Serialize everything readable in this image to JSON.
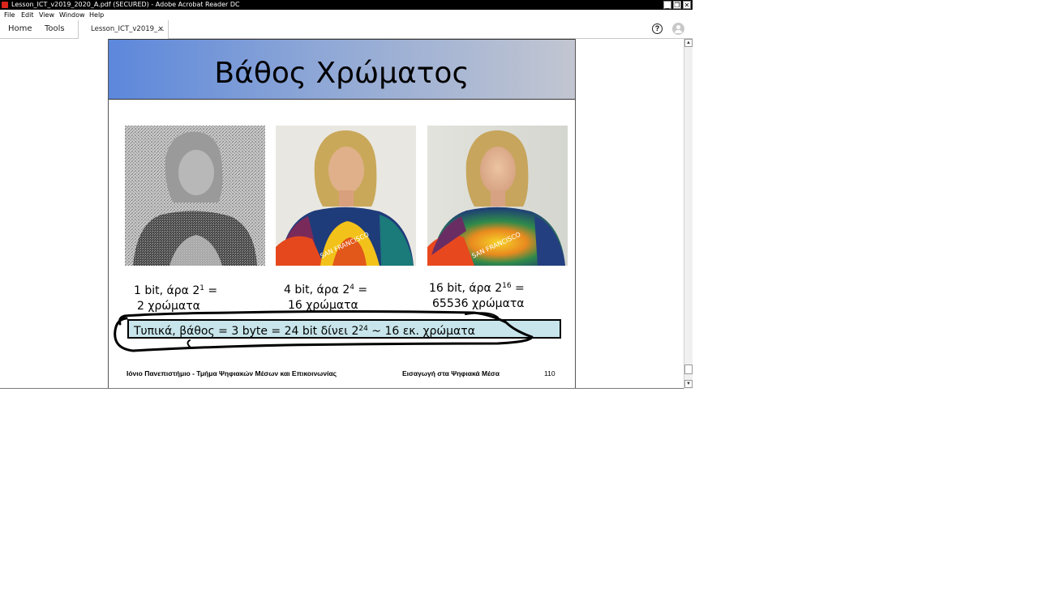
{
  "window": {
    "title": "Lesson_ICT_v2019_2020_A.pdf (SECURED) - Adobe Acrobat Reader DC",
    "minimize_label": "_",
    "restore_label": "❐",
    "close_label": "✕"
  },
  "menu": {
    "items": [
      "File",
      "Edit",
      "View",
      "Window",
      "Help"
    ]
  },
  "tabs": {
    "home_label": "Home",
    "tools_label": "Tools",
    "document_tab_label": "Lesson_ICT_v2019_...",
    "document_tab_close": "×",
    "help_label": "?"
  },
  "scrollbar": {
    "up_label": "▲",
    "down_label": "▼"
  },
  "slide": {
    "title": "Βάθος Χρώματος",
    "captions": [
      {
        "line1_prefix": "1 bit, άρα 2",
        "exponent": "1",
        "line1_suffix": " =",
        "line2": "2 χρώματα"
      },
      {
        "line1_prefix": "4 bit, άρα 2",
        "exponent": "4",
        "line1_suffix": " =",
        "line2": "16 χρώματα"
      },
      {
        "line1_prefix": "16 bit, άρα 2",
        "exponent": "16",
        "line1_suffix": " =",
        "line2": "65536 χρώματα"
      }
    ],
    "summary": {
      "prefix": "Τυπικά, βάθος = 3 byte = 24 bit δίνει 2",
      "exponent": "24",
      "suffix": " ~ 16 εκ. χρώματα"
    },
    "footer_left": "Ιόνιο Πανεπιστήμιο - Τμήμα Ψηφιακών Μέσων και Επικοινωνίας",
    "footer_mid": "Εισαγωγή στα Ψηφιακά Μέσα",
    "page_number": "110"
  },
  "colors": {
    "header_gradient_start": "#5c87db",
    "header_gradient_end": "#c2c6d1",
    "summary_box": "#c7e5ea",
    "acrobat_red": "#d9251c"
  },
  "icons": {
    "app": "acrobat-icon",
    "help": "help-icon",
    "user": "user-account-icon"
  }
}
